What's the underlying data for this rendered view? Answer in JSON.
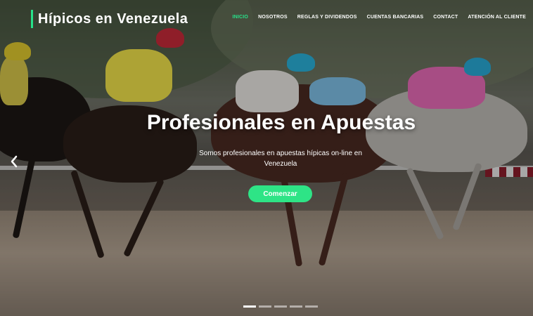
{
  "brand": {
    "title": "Hípicos en Venezuela",
    "accent": "#27e28a"
  },
  "nav": {
    "items": [
      {
        "label": "INICIO",
        "active": true
      },
      {
        "label": "NOSOTROS",
        "active": false
      },
      {
        "label": "REGLAS Y DIVIDENDOS",
        "active": false
      },
      {
        "label": "CUENTAS BANCARIAS",
        "active": false
      },
      {
        "label": "CONTACT",
        "active": false
      },
      {
        "label": "ATENCIÓN AL CLIENTE",
        "active": false
      }
    ]
  },
  "hero": {
    "headline": "Profesionales en Apuestas",
    "subtitle": "Somos profesionales en apuestas hípicas on-line en Venezuela",
    "cta_label": "Comenzar",
    "cta_color": "#2ee486",
    "prev_icon": "chevron-left-icon",
    "slides_count": 5,
    "active_slide": 1
  }
}
